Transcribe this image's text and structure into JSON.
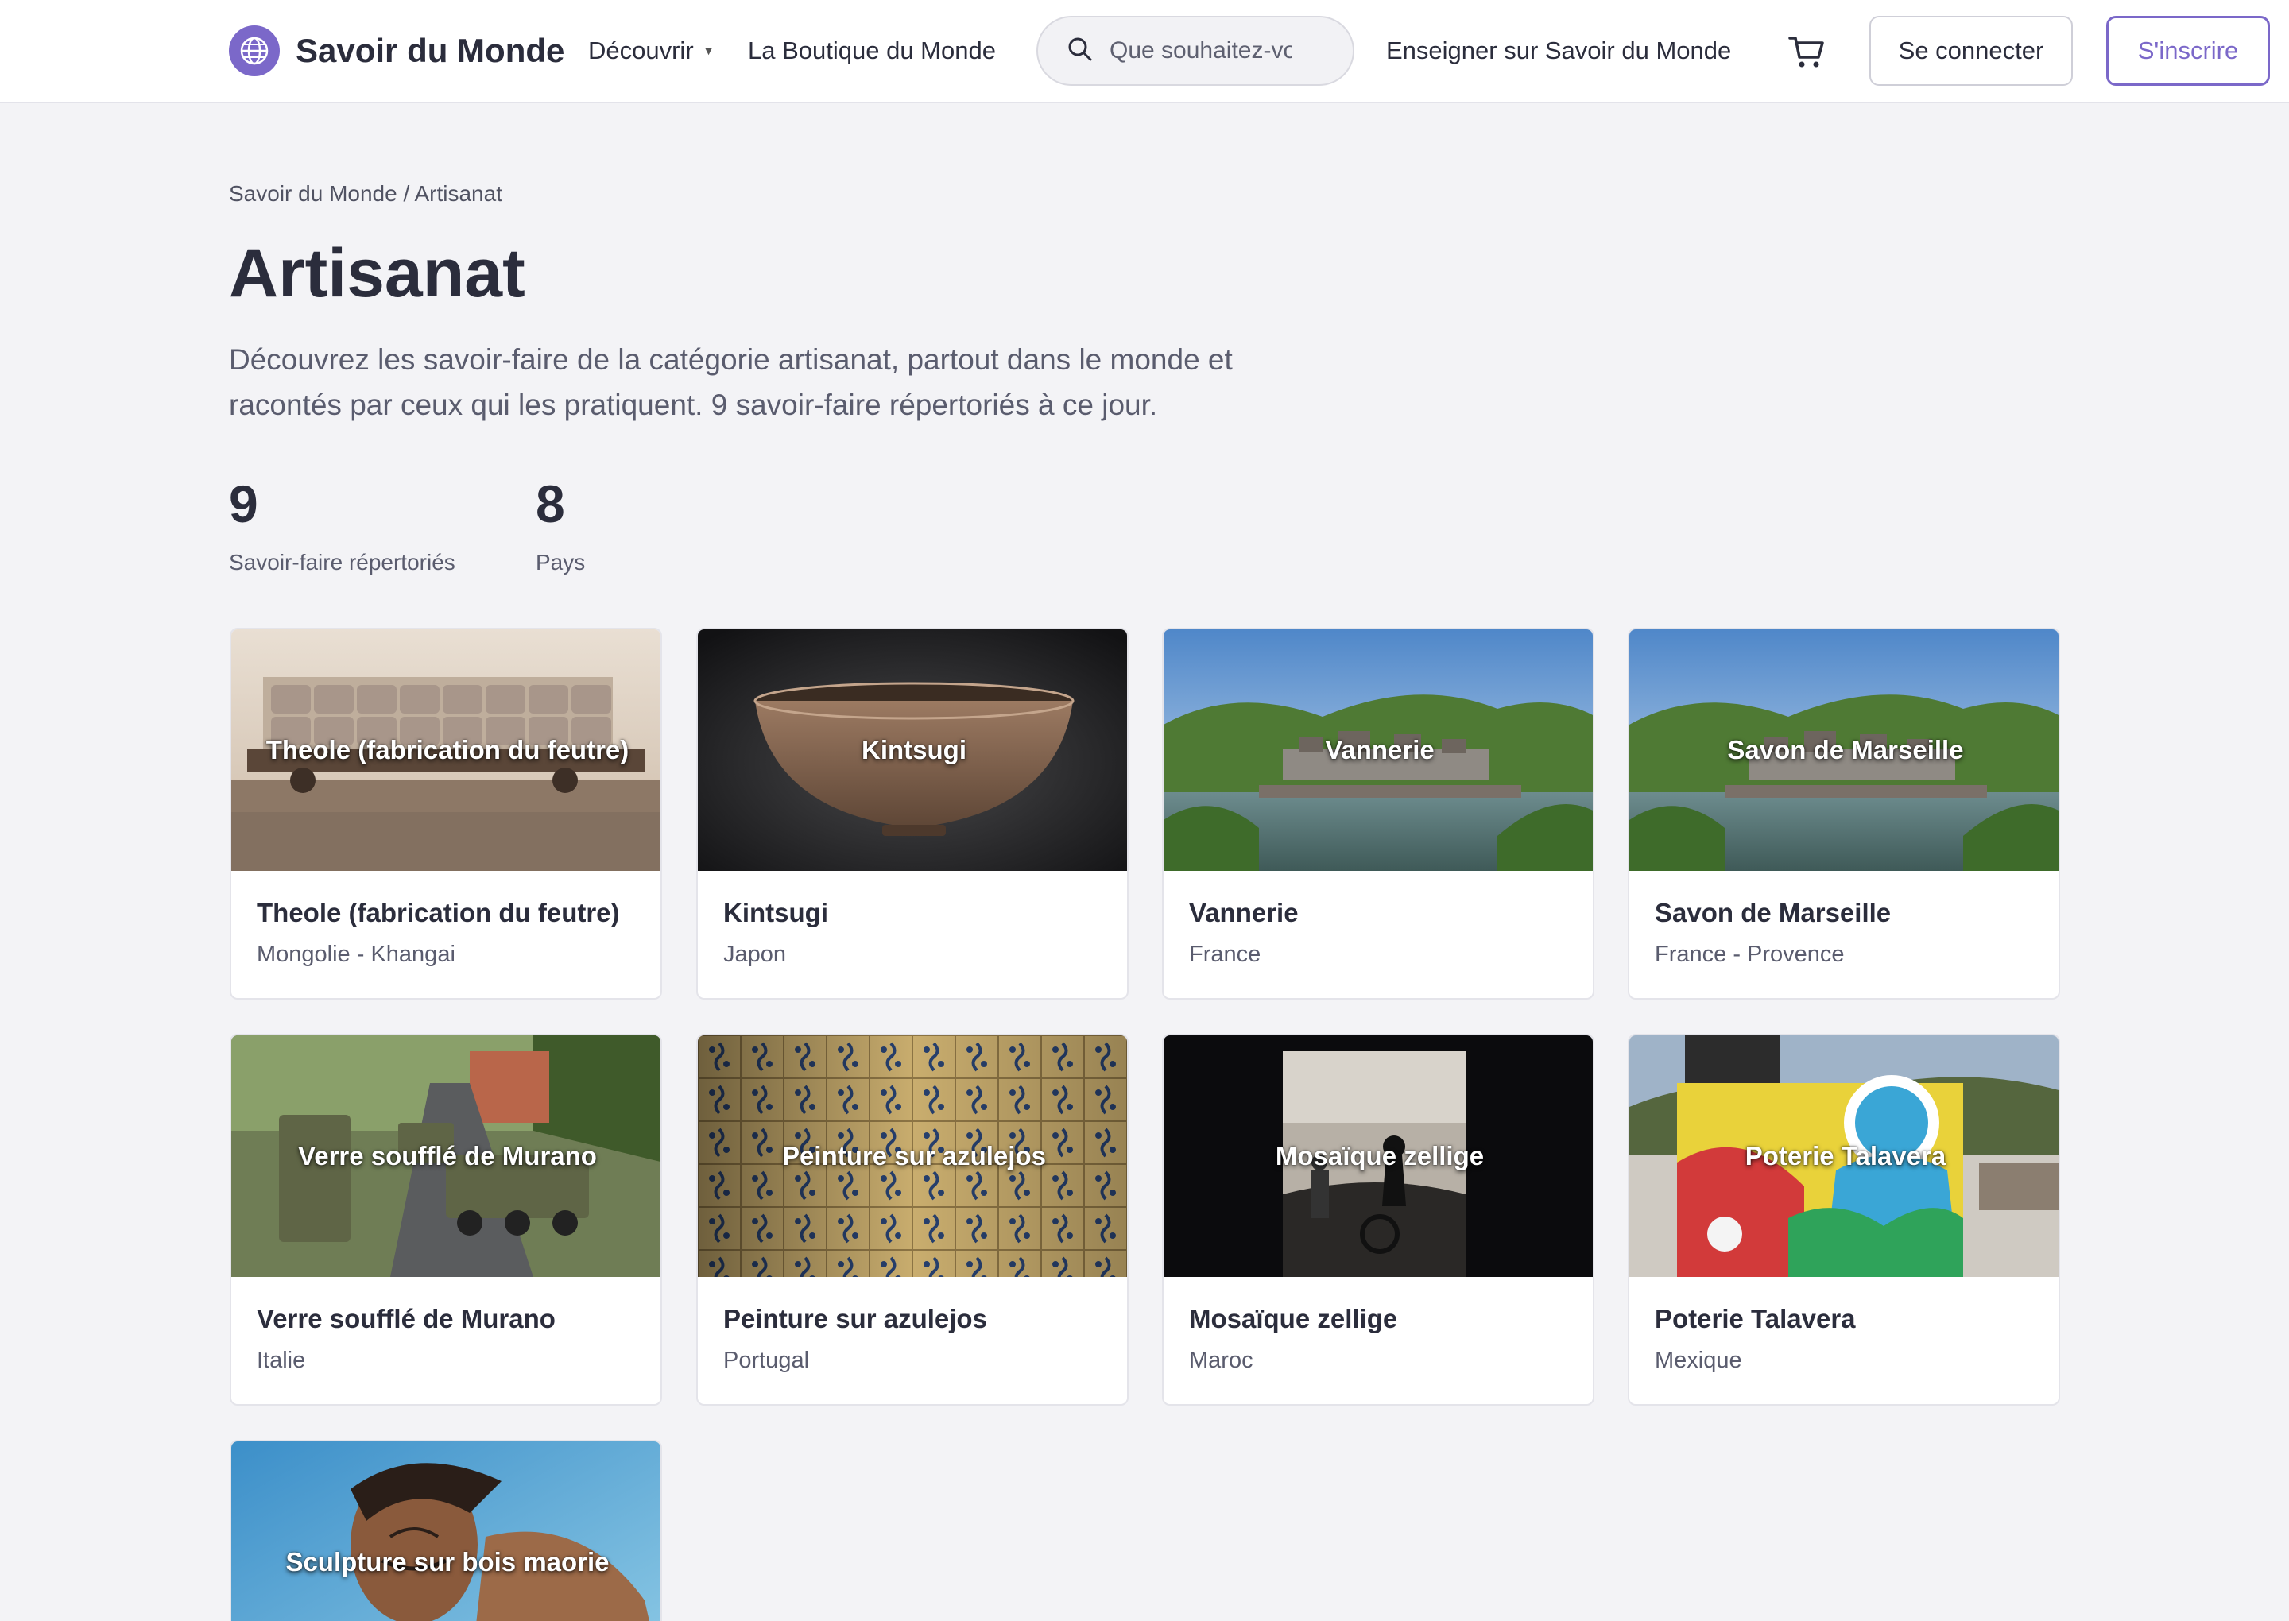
{
  "header": {
    "brand": "Savoir du Monde",
    "nav": {
      "discover": "Découvrir",
      "shop": "La Boutique du Monde",
      "teach": "Enseigner sur Savoir du Monde"
    },
    "search": {
      "placeholder": "Que souhaitez-vous apprendre ?"
    },
    "login": "Se connecter",
    "signup": "S'inscrire",
    "icons": [
      "globe-icon",
      "chevron-down-icon",
      "search-icon",
      "cart-icon"
    ]
  },
  "breadcrumb": "Savoir du Monde / Artisanat",
  "title": "Artisanat",
  "intro": "Découvrez les savoir-faire de la catégorie artisanat, partout dans le monde et racontés par ceux qui les pratiquent. 9 savoir-faire répertoriés à ce jour.",
  "stats": [
    {
      "value": "9",
      "label": "Savoir-faire répertoriés"
    },
    {
      "value": "8",
      "label": "Pays"
    }
  ],
  "cards": [
    {
      "title": "Theole (fabrication du feutre)",
      "place": "Mongolie - Khangai"
    },
    {
      "title": "Kintsugi",
      "place": "Japon"
    },
    {
      "title": "Vannerie",
      "place": "France"
    },
    {
      "title": "Savon de Marseille",
      "place": "France - Provence"
    },
    {
      "title": "Verre soufflé de Murano",
      "place": "Italie"
    },
    {
      "title": "Peinture sur azulejos",
      "place": "Portugal"
    },
    {
      "title": "Mosaïque zellige",
      "place": "Maroc"
    },
    {
      "title": "Poterie Talavera",
      "place": "Mexique"
    },
    {
      "title": "Sculpture sur bois maorie",
      "place": ""
    }
  ],
  "colors": {
    "accent": "#7b68c9",
    "background": "#f3f3f6",
    "text": "#2b2d3c"
  }
}
